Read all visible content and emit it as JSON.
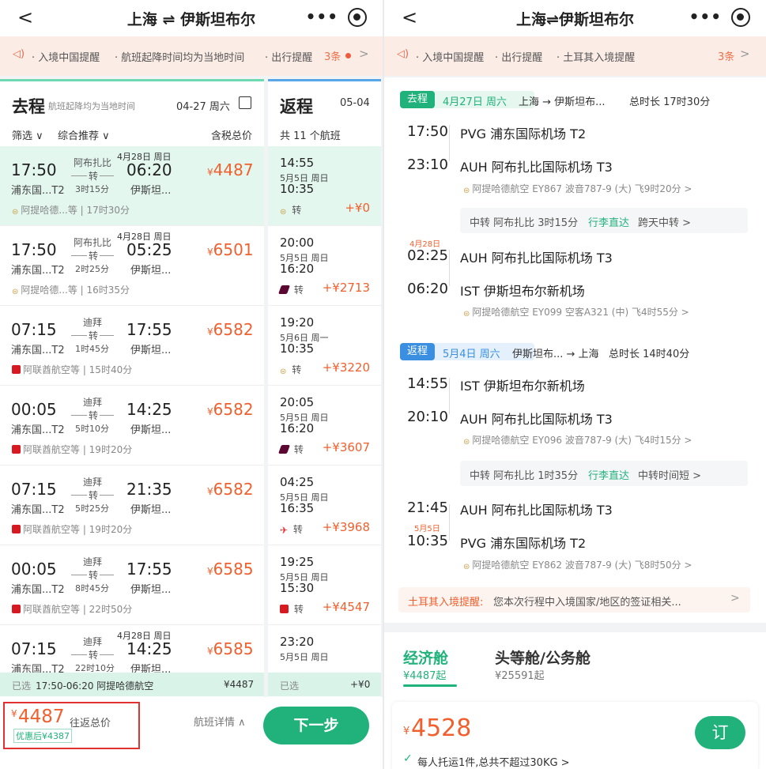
{
  "left": {
    "nav": {
      "back": "<",
      "title": "上海 ⇌ 伊斯坦布尔",
      "more": "•••"
    },
    "notice": {
      "items": [
        "· 入境中国提醒",
        "· 航班起降时间均为当地时间",
        "· 出行提醒"
      ],
      "count": "3条"
    },
    "outbound": {
      "header": "去程",
      "header_note": "航班起降均为当地时间",
      "date": "04-27 周六",
      "filter": "筛选 ∨",
      "sort": "综合推荐 ∨",
      "price_label": "含税总价",
      "flights": [
        {
          "dep": "17:50",
          "arr": "06:20",
          "dep_ap": "浦东国...T2",
          "arr_ap": "伊斯坦...",
          "via": "阿布扎比",
          "mode": "转",
          "dur": "3时15分",
          "next_day": "4月28日 周日",
          "airline": "阿提哈德...等 | 17时30分",
          "icon": "ey",
          "price": "4487"
        },
        {
          "dep": "17:50",
          "arr": "05:25",
          "dep_ap": "浦东国...T2",
          "arr_ap": "伊斯坦...",
          "via": "阿布扎比",
          "mode": "转",
          "dur": "2时25分",
          "next_day": "4月28日 周日",
          "airline": "阿提哈德...等 | 16时35分",
          "icon": "ey",
          "price": "6501"
        },
        {
          "dep": "07:15",
          "arr": "17:55",
          "dep_ap": "浦东国...T2",
          "arr_ap": "伊斯坦...",
          "via": "迪拜",
          "mode": "转",
          "dur": "1时45分",
          "next_day": "",
          "airline": "阿联酋航空等 | 15时40分",
          "icon": "ek",
          "price": "6582"
        },
        {
          "dep": "00:05",
          "arr": "14:25",
          "dep_ap": "浦东国...T2",
          "arr_ap": "伊斯坦...",
          "via": "迪拜",
          "mode": "转",
          "dur": "5时10分",
          "next_day": "",
          "airline": "阿联酋航空等 | 19时20分",
          "icon": "ek",
          "price": "6582"
        },
        {
          "dep": "07:15",
          "arr": "21:35",
          "dep_ap": "浦东国...T2",
          "arr_ap": "伊斯坦...",
          "via": "迪拜",
          "mode": "转",
          "dur": "5时25分",
          "next_day": "",
          "airline": "阿联酋航空等 | 19时20分",
          "icon": "ek",
          "price": "6582"
        },
        {
          "dep": "00:05",
          "arr": "17:55",
          "dep_ap": "浦东国...T2",
          "arr_ap": "伊斯坦...",
          "via": "迪拜",
          "mode": "转",
          "dur": "8时45分",
          "next_day": "",
          "airline": "阿联酋航空等 | 22时50分",
          "icon": "ek",
          "price": "6585"
        },
        {
          "dep": "07:15",
          "arr": "14:25",
          "dep_ap": "浦东国...T2",
          "arr_ap": "伊斯坦...",
          "via": "迪拜",
          "mode": "转",
          "dur": "22时10分",
          "next_day": "4月28日 周日",
          "airline": "",
          "icon": "ek",
          "price": "6585"
        }
      ],
      "selected_label": "已选",
      "selected_detail": "17:50-06:20 阿提哈德航空",
      "selected_price": "¥4487"
    },
    "return": {
      "header": "返程",
      "date": "05-04",
      "count": "共 11 个航班",
      "flights": [
        {
          "dep": "14:55",
          "date": "5月5日 周日",
          "arr": "10:35",
          "icon": "ey",
          "mode": "转",
          "delta": "+¥0"
        },
        {
          "dep": "20:00",
          "date": "5月5日 周日",
          "arr": "16:20",
          "icon": "qr",
          "mode": "转",
          "delta": "+¥2713"
        },
        {
          "dep": "19:20",
          "date": "5月6日 周一",
          "arr": "10:35",
          "icon": "ey",
          "mode": "转",
          "delta": "+¥3220"
        },
        {
          "dep": "20:05",
          "date": "5月5日 周日",
          "arr": "16:20",
          "icon": "qr",
          "mode": "转",
          "delta": "+¥3607"
        },
        {
          "dep": "04:25",
          "date": "5月5日 周日",
          "arr": "16:35",
          "icon": "tk",
          "mode": "转",
          "delta": "+¥3968"
        },
        {
          "dep": "19:25",
          "date": "5月5日 周日",
          "arr": "15:30",
          "icon": "ek",
          "mode": "转",
          "delta": "+¥4547"
        },
        {
          "dep": "23:20",
          "date": "5月5日 周日",
          "arr": "",
          "icon": "",
          "mode": "",
          "delta": ""
        }
      ],
      "selected_label": "已选",
      "selected_price": "+¥0"
    },
    "bottom": {
      "price": "4487",
      "price_label": "往返总价",
      "discount": "优惠后¥4387",
      "details": "航班详情 ∧",
      "next": "下一步"
    }
  },
  "right": {
    "nav": {
      "back": "<",
      "title": "上海⇌伊斯坦布尔",
      "more": "•••"
    },
    "notice": {
      "items": [
        "· 入境中国提醒",
        "· 出行提醒",
        "· 土耳其入境提醒"
      ],
      "count": "3条"
    },
    "outbound": {
      "tag": "去程",
      "date": "4月27日 周六",
      "route": "上海 → 伊斯坦布...",
      "total": "总时长 17时30分",
      "seg1": {
        "dep_time": "17:50",
        "dep_ap": "PVG 浦东国际机场 T2",
        "arr_time": "23:10",
        "arr_ap": "AUH 阿布扎比国际机场 T3",
        "info": "阿提哈德航空 EY867   波音787-9 (大)   飞9时20分 >"
      },
      "transfer": {
        "text": "中转 阿布扎比 3时15分",
        "bag": "行李直达",
        "note": "跨天中转 >"
      },
      "seg2": {
        "next_day": "4月28日",
        "dep_time": "02:25",
        "dep_ap": "AUH 阿布扎比国际机场 T3",
        "arr_time": "06:20",
        "arr_ap": "IST 伊斯坦布尔新机场",
        "info": "阿提哈德航空 EY099   空客A321 (中)   飞4时55分 >"
      }
    },
    "return": {
      "tag": "返程",
      "date": "5月4日 周六",
      "route": "伊斯坦布... → 上海",
      "total": "总时长 14时40分",
      "seg1": {
        "dep_time": "14:55",
        "dep_ap": "IST 伊斯坦布尔新机场",
        "arr_time": "20:10",
        "arr_ap": "AUH 阿布扎比国际机场 T3",
        "info": "阿提哈德航空 EY096   波音787-9 (大)   飞4时15分 >"
      },
      "transfer": {
        "text": "中转 阿布扎比 1时35分",
        "bag": "行李直达",
        "note": "中转时间短 >"
      },
      "seg2": {
        "next_day": "5月5日",
        "dep_time": "21:45",
        "dep_ap": "AUH 阿布扎比国际机场 T3",
        "arr_time": "10:35",
        "arr_ap": "PVG 浦东国际机场 T2",
        "info": "阿提哈德航空 EY862   波音787-9 (大)   飞8时50分 >"
      }
    },
    "turkey": {
      "label": "土耳其入境提醒:",
      "text": "您本次行程中入境国家/地区的签证相关..."
    },
    "cabin": {
      "tab1": "经济舱",
      "tab1_price": "¥4487起",
      "tab2": "头等舱/公务舱",
      "tab2_price": "¥25591起",
      "price": "4528",
      "baggage": "每人托运1件,总共不超过30KG >",
      "book": "订"
    }
  },
  "colors": {
    "green": "#21b27b",
    "orange": "#f0602e",
    "blue": "#3a8fe0"
  }
}
